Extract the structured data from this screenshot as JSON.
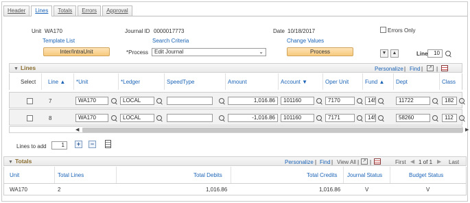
{
  "tabs": [
    "Header",
    "Lines",
    "Totals",
    "Errors",
    "Approval"
  ],
  "header": {
    "unit_label": "Unit",
    "unit_value": "WA170",
    "journal_id_label": "Journal ID",
    "journal_id_value": "0000017773",
    "date_label": "Date",
    "date_value": "10/18/2017",
    "errors_only_label": "Errors Only",
    "template_list": "Template List",
    "search_criteria": "Search Criteria",
    "change_values": "Change Values",
    "inter_intra_button": "Inter/IntraUnit",
    "process_label": "*Process",
    "process_value": "Edit Journal",
    "process_button": "Process",
    "line_label": "Line",
    "line_value": "10"
  },
  "lines_grid": {
    "title": "Lines",
    "personalize": "Personalize",
    "find": "Find",
    "columns": [
      "Select",
      "Line",
      "*Unit",
      "*Ledger",
      "SpeedType",
      "Amount",
      "Account",
      "Oper Unit",
      "Fund",
      "Dept",
      "Class"
    ],
    "rows": [
      {
        "line": "7",
        "unit": "WA170",
        "ledger": "LOCAL",
        "speedtype": "",
        "amount": "1,016.86",
        "account": "101160",
        "oper_unit": "7170",
        "fund": "145",
        "dept": "11722",
        "class": "182"
      },
      {
        "line": "8",
        "unit": "WA170",
        "ledger": "LOCAL",
        "speedtype": "",
        "amount": "-1,016.86",
        "account": "101160",
        "oper_unit": "7171",
        "fund": "145",
        "dept": "58260",
        "class": "112"
      }
    ]
  },
  "lines_to_add": {
    "label": "Lines to add",
    "value": "1"
  },
  "totals_grid": {
    "title": "Totals",
    "personalize": "Personalize",
    "find": "Find",
    "view_all": "View All",
    "first": "First",
    "range": "1 of 1",
    "last": "Last",
    "columns": [
      "Unit",
      "Total Lines",
      "Total Debits",
      "Total Credits",
      "Journal Status",
      "Budget Status"
    ],
    "row": {
      "unit": "WA170",
      "total_lines": "2",
      "total_debits": "1,016.86",
      "total_credits": "1,016.86",
      "journal_status": "V",
      "budget_status": "V"
    }
  }
}
